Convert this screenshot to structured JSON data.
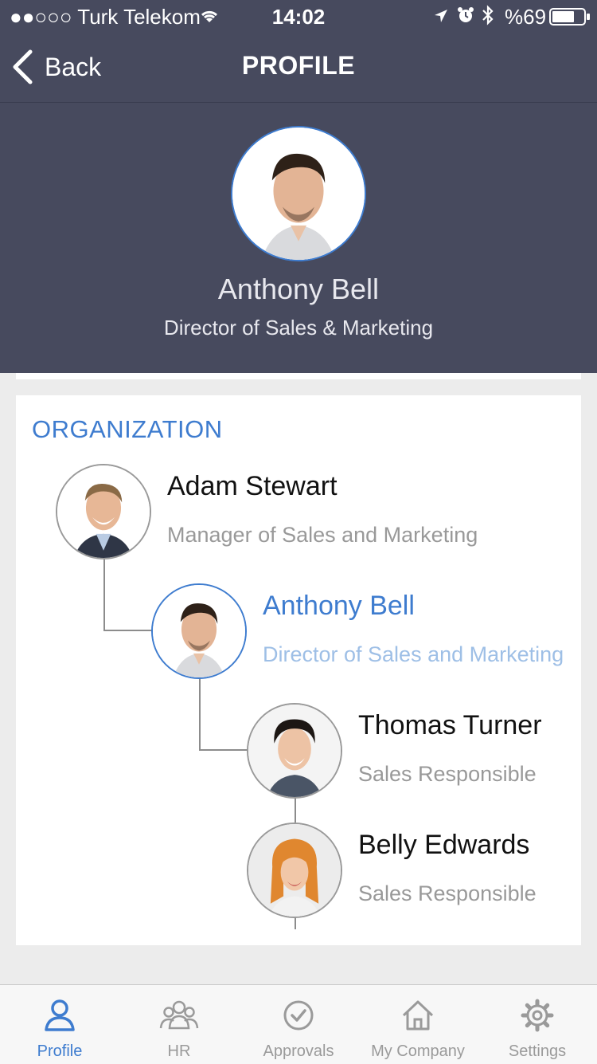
{
  "status_bar": {
    "carrier": "●●○○○ Turk Telekom",
    "time": "14:02",
    "battery": "%69"
  },
  "nav": {
    "back_label": "Back",
    "title": "PROFILE"
  },
  "profile": {
    "name": "Anthony Bell",
    "title": "Director of Sales & Marketing"
  },
  "organization": {
    "heading": "ORGANIZATION",
    "people": [
      {
        "name": "Adam Stewart",
        "title": "Manager of Sales and Marketing"
      },
      {
        "name": "Anthony Bell",
        "title": "Director of Sales and Marketing"
      },
      {
        "name": "Thomas Turner",
        "title": "Sales Responsible"
      },
      {
        "name": "Belly Edwards",
        "title": "Sales Responsible"
      }
    ]
  },
  "tabs": [
    {
      "label": "Profile",
      "icon": "person-icon"
    },
    {
      "label": "HR",
      "icon": "people-group-icon"
    },
    {
      "label": "Approvals",
      "icon": "check-circle-icon"
    },
    {
      "label": "My Company",
      "icon": "home-icon"
    },
    {
      "label": "Settings",
      "icon": "gear-icon"
    }
  ],
  "colors": {
    "header_bg": "#474a5e",
    "accent": "#3e7ccf",
    "selected_subtitle": "#9ebfe6",
    "page_bg": "#ececec"
  }
}
